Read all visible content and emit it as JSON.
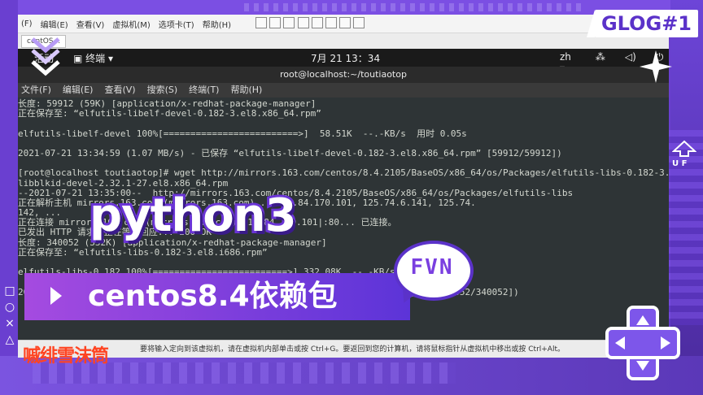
{
  "badge": "GLOG#1",
  "vm": {
    "menu": [
      "(F)",
      "编辑(E)",
      "查看(V)",
      "虚拟机(M)",
      "选项卡(T)",
      "帮助(H)"
    ],
    "tab": "centOS...",
    "status": "要将输入定向到该虚拟机，请在虚拟机内部单击或按 Ctrl+G。要返回到您的计算机，请将鼠标指针从虚拟机中移出或按 Ctrl+Alt。"
  },
  "gnome": {
    "activities": "活动",
    "app": "终端",
    "clock": "7月 21 13：34",
    "lang": "zh"
  },
  "terminal": {
    "title": "root@localhost:~/toutiaotop",
    "menu": [
      "文件(F)",
      "编辑(E)",
      "查看(V)",
      "搜索(S)",
      "终端(T)",
      "帮助(H)"
    ],
    "lines": [
      "长度: 59912 (59K) [application/x-redhat-package-manager]",
      "正在保存至: “elfutils-libelf-devel-0.182-3.el8.x86_64.rpm”",
      "",
      "elfutils-libelf-devel 100%[=========================>]  58.51K  --.-KB/s  用时 0.05s",
      "",
      "2021-07-21 13:34:59 (1.07 MB/s) - 已保存 “elfutils-libelf-devel-0.182-3.el8.x86_64.rpm” [59912/59912])",
      "",
      "[root@localhost toutiaotop]# wget http://mirrors.163.com/centos/8.4.2105/BaseOS/x86_64/os/Packages/elfutils-libs-0.182-3.el8.i686.rpm",
      "libblkid-devel-2.32.1-27.el8.x86_64.rpm",
      "--2021-07-21 13:35:00--  http://mirrors.163.com/centos/8.4.2105/BaseOS/x86_64/os/Packages/elfutils-libs",
      "正在解析主机 mirrors.163.com (mirrors.163.com)... 119.84.170.101, 125.74.6.141, 125.74.",
      "142, ...",
      "正在连接 mirrors.163.com (mirrors.163.com)|119.84.170.101|:80... 已连接。",
      "已发出 HTTP 请求，正在等待回应... 200 OK",
      "长度: 340052 (332K) [application/x-redhat-package-manager]",
      "正在保存至: “elfutils-libs-0.182-3.el8.i686.rpm”",
      "",
      "elfutils-libs-0.182 100%[=========================>] 332.08K  --.-KB/s  用时 0.1s",
      "",
      "2021-07-21 13:35:01 (3.19 MB/s) - 已保存 “elfutils-libs-0.182-3.el8.i686.rpm” [340052/340052])",
      "",
      "",
      "",
      ""
    ]
  },
  "overlay": {
    "title": "python3",
    "subtitle": "centos8.4依赖包",
    "bubble": "FVN",
    "red": "嘁绯雪沫筒",
    "shapes": [
      "□",
      "○",
      "×",
      "△"
    ],
    "uf": "U F"
  }
}
